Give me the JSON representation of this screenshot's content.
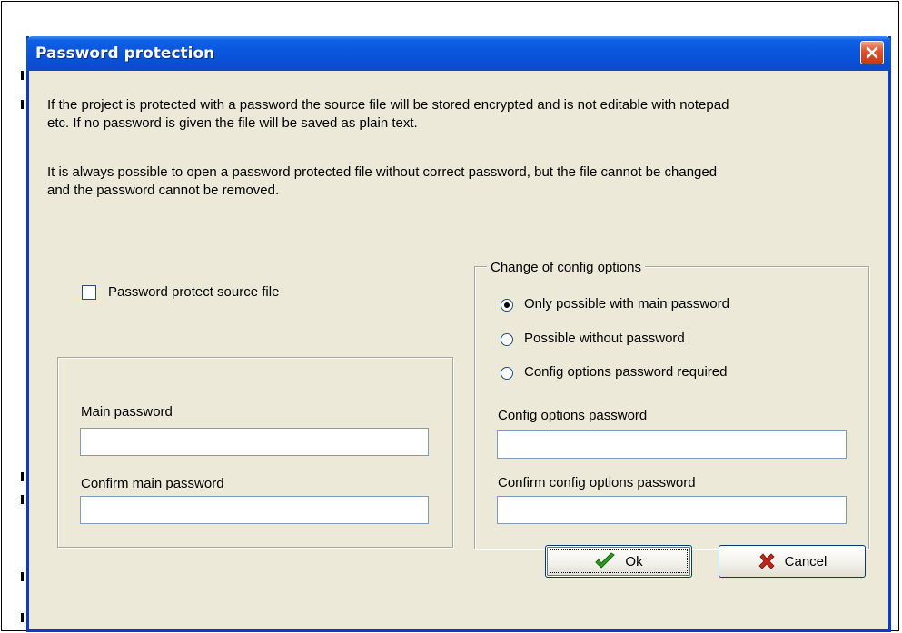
{
  "dialog": {
    "title": "Password protection",
    "description_1_line_1": "If the project is protected with a password the source file will be stored encrypted and is not editable with notepad",
    "description_1_line_2": "etc. If no password is given the file will be saved as plain text.",
    "description_2_line_1": "It is always possible to open a password protected file without correct password, but the file cannot be changed",
    "description_2_line_2": "and the password cannot be removed."
  },
  "protect_checkbox": {
    "label": "Password protect source file",
    "checked": false
  },
  "main_password": {
    "label": "Main password",
    "value": "",
    "confirm_label": "Confirm main password",
    "confirm_value": ""
  },
  "config_options": {
    "group_label": "Change of config options",
    "radios": [
      {
        "label": "Only possible with main password",
        "selected": true
      },
      {
        "label": "Possible without password",
        "selected": false
      },
      {
        "label": "Config options password required",
        "selected": false
      }
    ],
    "password_label": "Config options password",
    "password_value": "",
    "confirm_label": "Confirm config options password",
    "confirm_value": ""
  },
  "buttons": {
    "ok_label": "Ok",
    "cancel_label": "Cancel"
  },
  "colors": {
    "titlebar": "#0a56dc",
    "dialog_bg": "#ece9d8",
    "ok_check": "#2a9a1f",
    "cancel_x": "#c0271a",
    "close_button": "#e0552d"
  },
  "icons": {
    "close": "close-icon",
    "ok": "checkmark-icon",
    "cancel": "cross-icon"
  }
}
